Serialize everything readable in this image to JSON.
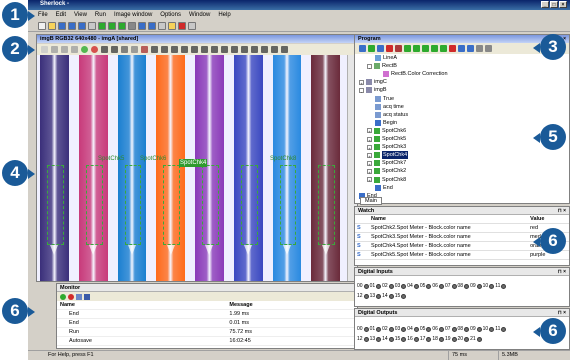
{
  "window": {
    "title": "Sherlock -"
  },
  "menu": [
    "File",
    "Edit",
    "View",
    "Run",
    "Image window",
    "Options",
    "Window",
    "Help"
  ],
  "image_pane": {
    "title": "imgB RGB32 640x480 - imgA [shared]",
    "spots": [
      "SpotChk5",
      "SpotChk6",
      "SpotChk4",
      "SpotChk8"
    ],
    "strip_colors": [
      "#3a2f7a",
      "#c83a7a",
      "#1a7fd0",
      "#ff6a1a",
      "#8a3ab8",
      "#3a48c0",
      "#2a8ae0",
      "#6a2a3a"
    ]
  },
  "monitor": {
    "title": "Monitor",
    "columns": [
      "Name",
      "Message"
    ],
    "rows": [
      [
        "End",
        "1.99 ms"
      ],
      [
        "End",
        "0.01 ms"
      ],
      [
        "Run",
        "75.72 ms"
      ],
      [
        "Autosave",
        "16:02:45"
      ]
    ]
  },
  "status": {
    "help": "For Help, press F1",
    "time": "75 ms",
    "mem": "5.3MB"
  },
  "program": {
    "title": "Program",
    "tab": "Main",
    "tree": [
      {
        "label": "LineA",
        "level": 2,
        "icon": "line"
      },
      {
        "label": "RectB",
        "level": 1,
        "icon": "rect",
        "expander": "-"
      },
      {
        "label": "RectB.Color Correction",
        "level": 3,
        "icon": "fn"
      },
      {
        "label": "imgC",
        "level": 0,
        "icon": "img",
        "expander": "+"
      },
      {
        "label": "imgB",
        "level": 0,
        "icon": "img",
        "expander": "-"
      },
      {
        "label": "True",
        "level": 2,
        "icon": "var"
      },
      {
        "label": "acq time",
        "level": 2,
        "icon": "var"
      },
      {
        "label": "acq status",
        "level": 2,
        "icon": "var"
      },
      {
        "label": "Begin",
        "level": 2,
        "icon": "begin"
      },
      {
        "label": "SpotChk6",
        "level": 1,
        "icon": "spot",
        "expander": "+"
      },
      {
        "label": "SpotChk5",
        "level": 1,
        "icon": "spot",
        "expander": "+"
      },
      {
        "label": "SpotChk3",
        "level": 1,
        "icon": "spot",
        "expander": "+"
      },
      {
        "label": "SpotChk4",
        "level": 1,
        "icon": "spot",
        "expander": "+",
        "selected": true
      },
      {
        "label": "SpotChk7",
        "level": 1,
        "icon": "spot",
        "expander": "+"
      },
      {
        "label": "SpotChk2",
        "level": 1,
        "icon": "spot",
        "expander": "+"
      },
      {
        "label": "SpotChk8",
        "level": 1,
        "icon": "spot",
        "expander": "+"
      },
      {
        "label": "End",
        "level": 2,
        "icon": "end"
      },
      {
        "label": "End",
        "level": 0,
        "icon": "end"
      }
    ]
  },
  "watch": {
    "title": "Watch",
    "columns": [
      "Name",
      "Value"
    ],
    "rows": [
      [
        "SpotChk2.Spot Meter - Block.color name",
        "red"
      ],
      [
        "SpotChk3.Spot Meter - Block.color name",
        "med blue"
      ],
      [
        "SpotChk4.Spot Meter - Block.color name",
        "orange"
      ],
      [
        "SpotChk5.Spot Meter - Block.color name",
        "purple"
      ]
    ]
  },
  "digital_inputs": {
    "title": "Digital Inputs",
    "row1": [
      "00",
      "01",
      "02",
      "03",
      "04",
      "05",
      "06",
      "07",
      "08",
      "09",
      "10",
      "11"
    ],
    "row2": [
      "12",
      "13",
      "14",
      "15"
    ]
  },
  "digital_outputs": {
    "title": "Digital Outputs",
    "row1": [
      "00",
      "01",
      "02",
      "03",
      "04",
      "05",
      "06",
      "07",
      "08",
      "09",
      "10",
      "11"
    ],
    "row2": [
      "12",
      "13",
      "14",
      "15",
      "16",
      "17",
      "18",
      "19",
      "20",
      "21"
    ]
  },
  "callouts": [
    "1",
    "2",
    "3",
    "4",
    "5",
    "6",
    "6",
    "6"
  ]
}
